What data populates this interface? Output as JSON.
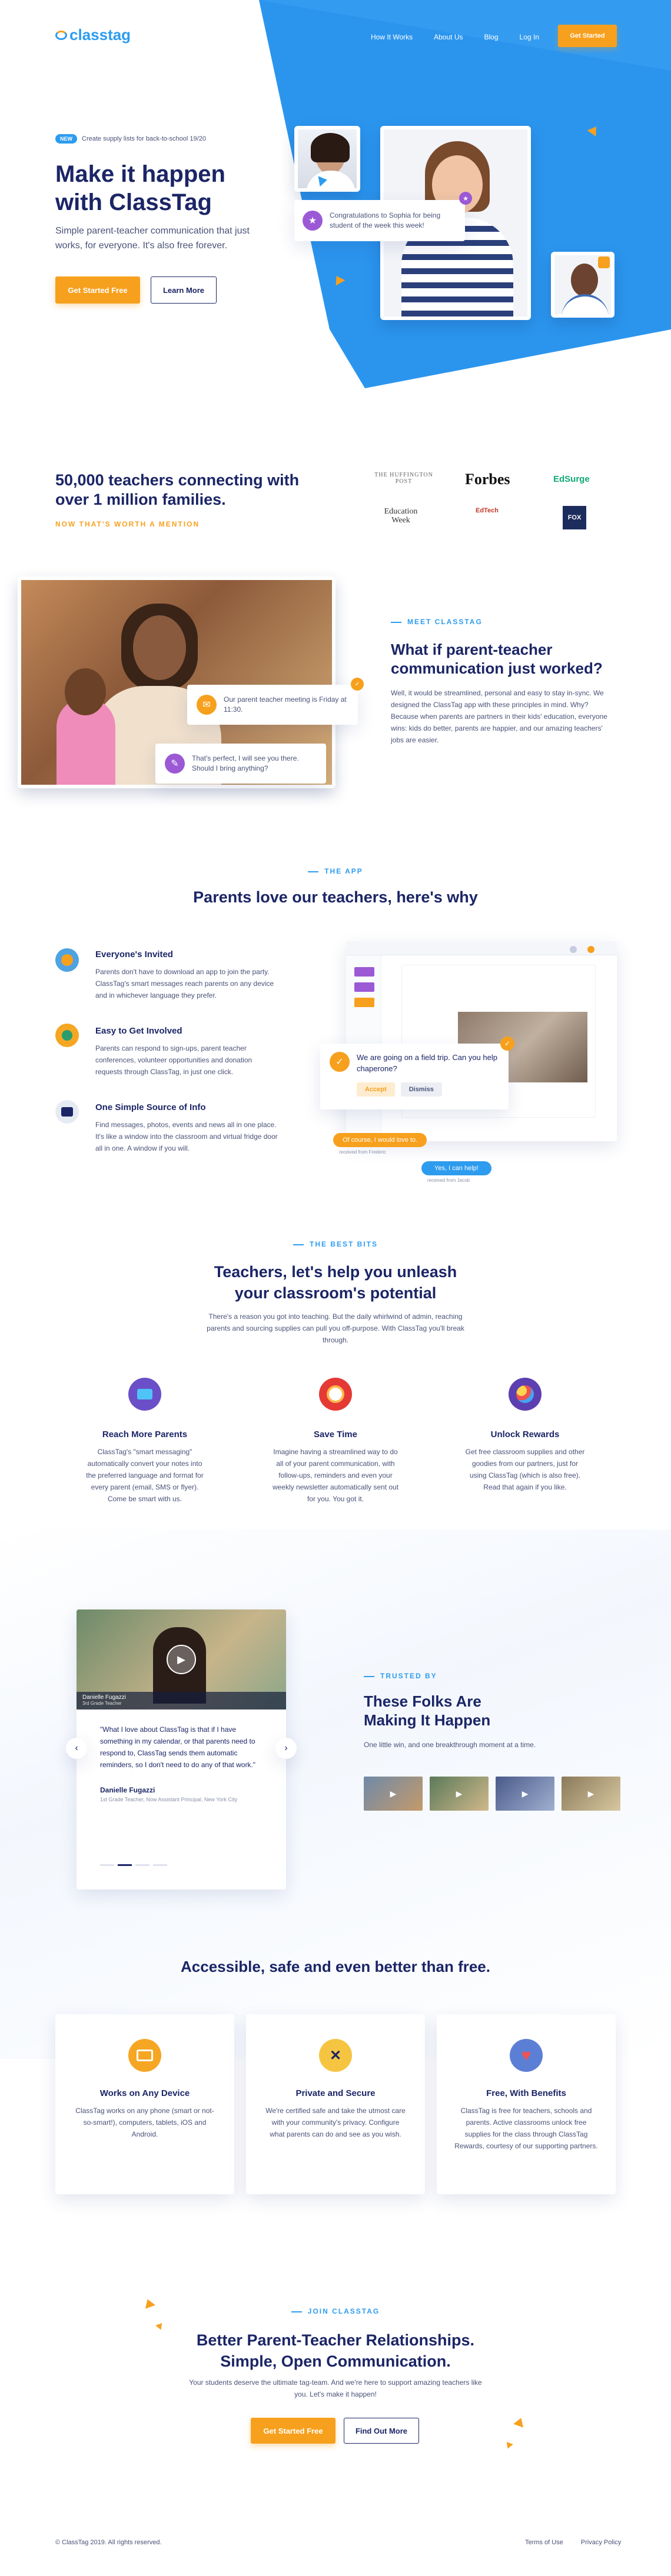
{
  "colors": {
    "accent": "#f7a01d",
    "brand_blue": "#2d9cef",
    "navy": "#1b2566"
  },
  "nav": {
    "logo": "classtag",
    "links": [
      "How It Works",
      "About Us",
      "Blog",
      "Log In"
    ],
    "cta": "Get Started"
  },
  "hero": {
    "badge": "NEW",
    "badge_text": "Create supply lists for back-to-school 19/20",
    "title_1": "Make it happen",
    "title_2": "with ClassTag",
    "subtitle": "Simple parent-teacher communication that just works, for everyone. It's also free forever.",
    "primary": "Get Started Free",
    "secondary": "Learn More",
    "bubble": "Congratulations to Sophia for being student of the week this week!"
  },
  "press": {
    "headline": "50,000 teachers connecting with over 1 million families.",
    "sub": "NOW THAT'S WORTH A MENTION",
    "logos": [
      "THE HUFFINGTON POST",
      "Forbes",
      "EdSurge",
      "Education Week",
      "EdTech",
      "FOX"
    ]
  },
  "meet": {
    "eyebrow": "MEET CLASSTAG",
    "title_1": "What if parent-teacher",
    "title_2": "communication just worked?",
    "body": "Well, it would be streamlined, personal and easy to stay in-sync. We designed the ClassTag app with these principles in mind. Why? Because when parents are partners in their kids' education, everyone wins: kids do better, parents are happier, and our amazing teachers' jobs are easier.",
    "bubble1": "Our parent teacher meeting is Friday at 11:30.",
    "bubble2": "That's perfect, I will see you there. Should I bring anything?"
  },
  "app": {
    "eyebrow": "THE APP",
    "title": "Parents love our teachers, here's why",
    "features": [
      {
        "title": "Everyone's Invited",
        "text": "Parents don't have to download an app to join the party. ClassTag's smart messages reach parents on any device and in whichever language they prefer."
      },
      {
        "title": "Easy to Get Involved",
        "text": "Parents can respond to sign-ups, parent teacher conferences, volunteer opportunities and donation requests through ClassTag, in just one click."
      },
      {
        "title": "One Simple Source of Info",
        "text": "Find messages, photos, events and news all in one place. It's like a window into the classroom and virtual fridge door all in one. A window if you will."
      }
    ],
    "popup": "We are going on a field trip. Can you help chaperone?",
    "accept": "Accept",
    "dismiss": "Dismiss",
    "chip1": "Of course, I would love to.",
    "chip2": "Yes, I can help!",
    "note": "received from Frederic",
    "note2": "received from Jacob"
  },
  "bits": {
    "eyebrow": "THE BEST BITS",
    "title_1": "Teachers, let's help you unleash",
    "title_2": "your classroom's potential",
    "body": "There's a reason you got into teaching. But the daily whirlwind of admin, reaching parents and sourcing supplies can pull you off-purpose. With ClassTag you'll break through.",
    "cols": [
      {
        "title": "Reach More Parents",
        "text": "ClassTag's \"smart messaging\" automatically convert your notes into the preferred language and format for every parent (email, SMS or flyer). Come be smart with us."
      },
      {
        "title": "Save Time",
        "text": "Imagine having a streamlined way to do all of your parent communication, with follow-ups, reminders and even your weekly newsletter automatically sent out for you. You got it."
      },
      {
        "title": "Unlock Rewards",
        "text": "Get free classroom supplies and other goodies from our partners, just for using ClassTag (which is also free). Read that again if you like."
      }
    ]
  },
  "trusted": {
    "eyebrow": "TRUSTED BY",
    "title_1": "These Folks Are",
    "title_2": "Making It Happen",
    "sub": "One little win, and one breakthrough moment at a time.",
    "video_name": "Danielle Fugazzi",
    "video_role": "3rd Grade Teacher",
    "quote": "\"What I love about ClassTag is that if I have something in my calendar, or that parents need to respond to, ClassTag sends them automatic reminders, so I don't need to do any of that work.\"",
    "author": "Danielle Fugazzi",
    "author_role": "1st Grade Teacher, Now Assistant Principal, New York City"
  },
  "access": {
    "title": "Accessible, safe and even better than free.",
    "cols": [
      {
        "title": "Works on Any Device",
        "text": "ClassTag works on any phone (smart or not-so-smart!), computers, tablets, iOS and Android."
      },
      {
        "title": "Private and Secure",
        "text": "We're certified safe and take the utmost care with your community's privacy. Configure what parents can do and see as you wish."
      },
      {
        "title": "Free, With Benefits",
        "text": "ClassTag is free for teachers, schools and parents. Active classrooms unlock free supplies for the class through ClassTag Rewards, courtesy of our supporting partners."
      }
    ]
  },
  "join": {
    "eyebrow": "JOIN CLASSTAG",
    "title_1": "Better Parent-Teacher Relationships.",
    "title_2": "Simple, Open Communication.",
    "body": "Your students deserve the ultimate tag-team. And we're here to support amazing teachers like you. Let's make it happen!",
    "primary": "Get Started Free",
    "secondary": "Find Out More"
  },
  "footer": {
    "copy": "© ClassTag 2019. All rights reserved.",
    "links": [
      "Terms of Use",
      "Privacy Policy"
    ]
  }
}
